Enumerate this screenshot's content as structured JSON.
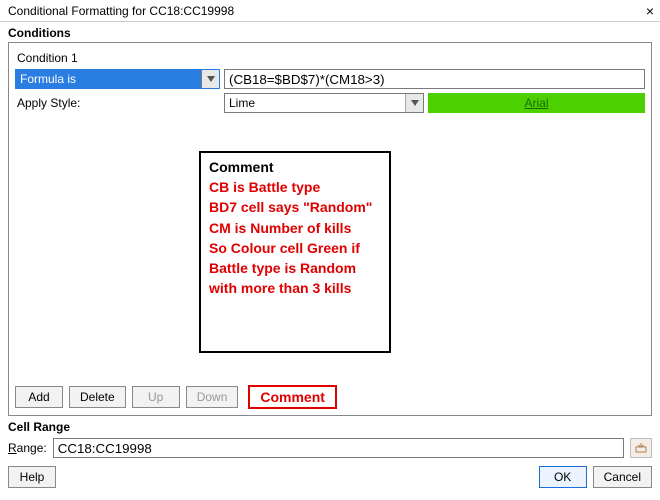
{
  "window": {
    "title": "Conditional Formatting for CC18:CC19998"
  },
  "sections": {
    "conditions": "Conditions",
    "cell_range": "Cell Range"
  },
  "condition": {
    "header": "Condition 1",
    "type_combo": "Formula is",
    "formula_value": "(CB18=$BD$7)*(CM18>3)",
    "apply_style_label": "Apply Style:",
    "style_combo": "Lime",
    "preview_text": "Arial"
  },
  "comment_box": {
    "title": "Comment",
    "lines": [
      "CB is Battle type",
      "BD7 cell says \"Random\"",
      "CM is Number of kills",
      "So Colour cell Green if",
      "Battle type is Random",
      "with more than 3 kills"
    ]
  },
  "buttons": {
    "add": "Add",
    "delete": "Delete",
    "up": "Up",
    "down": "Down",
    "comment": "Comment",
    "help": "Help",
    "ok": "OK",
    "cancel": "Cancel"
  },
  "range": {
    "label_prefix": "R",
    "label_rest": "ange:",
    "value": "CC18:CC19998"
  }
}
